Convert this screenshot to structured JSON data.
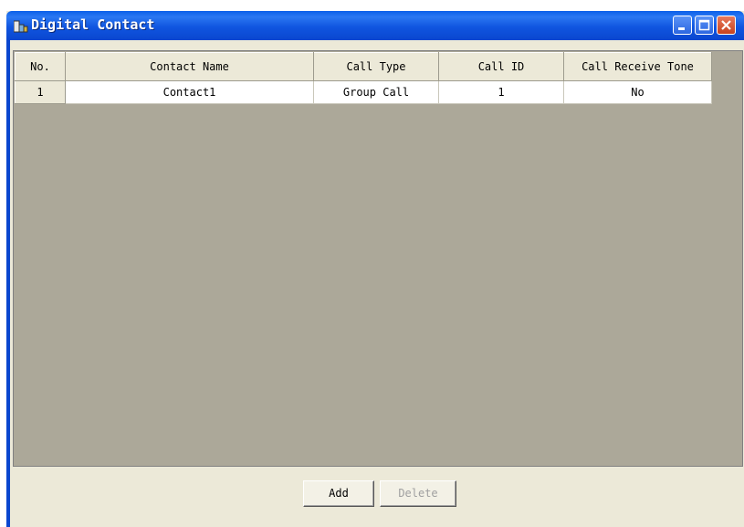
{
  "window": {
    "title": "Digital Contact",
    "title_icon": "app-icon",
    "controls": [
      "minimize-icon",
      "maximize-icon",
      "close-icon"
    ]
  },
  "table": {
    "columns": [
      "No.",
      "Contact Name",
      "Call Type",
      "Call ID",
      "Call Receive Tone"
    ],
    "rows": [
      [
        "1",
        "Contact1",
        "Group Call",
        "1",
        "No"
      ]
    ]
  },
  "buttons": {
    "add_label": "Add",
    "delete_label": "Delete"
  },
  "colors": {
    "titlebar": "#0a46cf",
    "grid_background": "#aca899",
    "dialog_background": "#ece9d8"
  }
}
